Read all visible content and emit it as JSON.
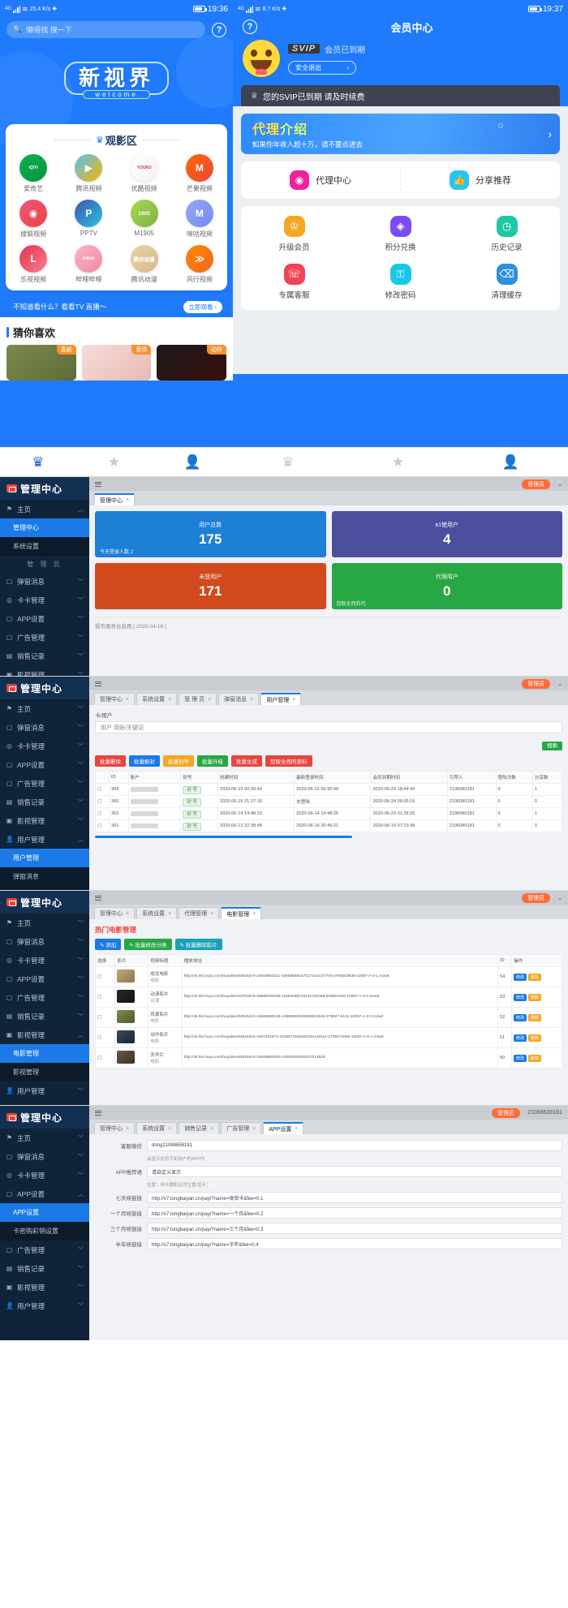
{
  "phone_home": {
    "status": {
      "network": "4G",
      "speed": "25.4 K/s",
      "time": "19:36"
    },
    "search_placeholder": "懒得找 搜一下",
    "help_icon": "question-mark-icon",
    "logo_text": "新视界",
    "logo_sub": "welcome",
    "section_title": "观影区",
    "sites": [
      {
        "name": "爱奇艺",
        "mark": "iQIYI",
        "c1": "#0cb04a",
        "c2": "#0a9440"
      },
      {
        "name": "腾讯视频",
        "mark": "▶",
        "c1": "#4fc3f7",
        "c2": "#ffb300"
      },
      {
        "name": "优酷视频",
        "mark": "YOUKU",
        "c1": "#ffffff",
        "c2": "#f2f2f2"
      },
      {
        "name": "芒果视频",
        "mark": "M",
        "c1": "#ff6a00",
        "c2": "#e8453c"
      },
      {
        "name": "搜狐视频",
        "mark": "◉",
        "c1": "#f2557f",
        "c2": "#e8453c"
      },
      {
        "name": "PPTV",
        "mark": "P",
        "c1": "#3f51b5",
        "c2": "#26c6da"
      },
      {
        "name": "M1905",
        "mark": "1905",
        "c1": "#a8d94f",
        "c2": "#7cb342"
      },
      {
        "name": "咪咕视频",
        "mark": "M",
        "c1": "#9aa7f0",
        "c2": "#6f8bf5"
      },
      {
        "name": "乐视视频",
        "mark": "L",
        "c1": "#e8304f",
        "c2": "#f2828f"
      },
      {
        "name": "哔哩哔哩",
        "mark": "bilibili",
        "c1": "#f7b3c2",
        "c2": "#f48aa4"
      },
      {
        "name": "腾讯动漫",
        "mark": "腾讯动漫",
        "c1": "#e8d3a8",
        "c2": "#d6b989"
      },
      {
        "name": "风行视频",
        "mark": "≫",
        "c1": "#ff8a00",
        "c2": "#f26522"
      }
    ],
    "ad_text": "不知道看什么？看看TV 直播～",
    "ad_button": "立即观看",
    "recommend_title": "猜你喜欢",
    "recommend": [
      {
        "tag": "喜剧",
        "c1": "#7c8a4e",
        "c2": "#5e6b3a"
      },
      {
        "tag": "爱情",
        "c1": "#f6dcd8",
        "c2": "#e8b9b4"
      },
      {
        "tag": "动作",
        "c1": "#1a1a1a",
        "c2": "#3a0d0d"
      }
    ],
    "bottom_nav": [
      {
        "icon": "crown-icon",
        "active": true
      },
      {
        "icon": "star-icon",
        "active": false
      },
      {
        "icon": "person-icon",
        "active": false
      }
    ]
  },
  "phone_member": {
    "status": {
      "network": "4G",
      "speed": "8.7 K/s",
      "time": "19:37"
    },
    "title": "会员中心",
    "help_icon": "question-mark-icon",
    "avatar": "smiley-face-avatar",
    "svip_badge": "SVIP",
    "svip_status": "会员已到期",
    "logout_label": "安全退出",
    "notice": "您的SVIP已到期 请及时续费",
    "banner": {
      "title_a": "代理",
      "title_b": "介绍",
      "subtitle": "如果你年收入超十万，请不要点进去"
    },
    "quick_rows": [
      {
        "label": "代理中心",
        "icon": "agent-icon",
        "color": "#f0229b"
      },
      {
        "label": "分享推荐",
        "icon": "thumbs-up-icon",
        "color": "#25c6f5"
      }
    ],
    "grid": [
      {
        "label": "升级会员",
        "icon": "trophy-icon",
        "color": "#f5a623"
      },
      {
        "label": "积分兑换",
        "icon": "coin-bag-icon",
        "color": "#7b4df0"
      },
      {
        "label": "历史记录",
        "icon": "clock-icon",
        "color": "#1ec8a5"
      },
      {
        "label": "专属客服",
        "icon": "headset-icon",
        "color": "#ee4455"
      },
      {
        "label": "修改密码",
        "icon": "lock-icon",
        "color": "#18c8e8"
      },
      {
        "label": "清理缓存",
        "icon": "broom-icon",
        "color": "#2d8fe0"
      }
    ],
    "bottom_nav": [
      {
        "icon": "crown-icon",
        "active": false
      },
      {
        "icon": "star-icon",
        "active": false
      },
      {
        "icon": "person-icon",
        "active": true
      }
    ]
  },
  "admin_common": {
    "brand": "管理中心",
    "badge": "管理员",
    "menu": [
      {
        "label": "主页",
        "icon": "flag-icon",
        "expandable": true
      },
      {
        "label": "管理中心",
        "icon": "home-icon",
        "sub": true
      },
      {
        "label": "系统设置",
        "icon": "gear-icon",
        "sub": true
      },
      {
        "label": "管 理 员",
        "group": true
      },
      {
        "label": "弹窗消息",
        "icon": "bell-icon",
        "expandable": true
      },
      {
        "label": "卡卡管理",
        "icon": "card-icon",
        "expandable": true
      },
      {
        "label": "APP设置",
        "icon": "app-icon",
        "expandable": true
      },
      {
        "label": "广告管理",
        "icon": "ad-icon",
        "expandable": true
      },
      {
        "label": "销售记录",
        "icon": "list-icon",
        "expandable": true
      },
      {
        "label": "影视管理",
        "icon": "film-icon",
        "expandable": true
      },
      {
        "label": "用户管理",
        "icon": "user-icon",
        "expandable": true
      }
    ]
  },
  "admin_dashboard": {
    "tabs": [
      {
        "label": "管理中心",
        "active": true
      }
    ],
    "badge": "管理员",
    "cards": [
      {
        "label": "用户总数",
        "value": "175",
        "foot": "今天登录人数 2",
        "color": "#1e7fd6"
      },
      {
        "label": "в1使用户",
        "value": "4",
        "foot": "",
        "color": "#4b4f9e"
      },
      {
        "label": "未登用户",
        "value": "171",
        "foot": "",
        "color": "#d2491b"
      },
      {
        "label": "代理用户",
        "value": "0",
        "foot": "您取全而的代",
        "color": "#27a844"
      }
    ],
    "footer": "投币服务台启用 [ 2020-04-16 ]"
  },
  "admin_users": {
    "badge": "管理员",
    "tabs": [
      {
        "label": "管理中心",
        "active": false
      },
      {
        "label": "系统设置",
        "active": false
      },
      {
        "label": "管 理 员",
        "active": false
      },
      {
        "label": "弹窗消息",
        "active": false
      },
      {
        "label": "用户管理",
        "active": true
      }
    ],
    "filter_label": "卡/用户",
    "search_placeholder": "用户 用账/关键词",
    "search_button": "搜索",
    "buttons": [
      {
        "label": "批量删除",
        "color": "#e8453c"
      },
      {
        "label": "批量解封",
        "color": "#1b7ae8"
      },
      {
        "label": "批量封号",
        "color": "#f5a623"
      },
      {
        "label": "批量升级",
        "color": "#27a844"
      },
      {
        "label": "批量生成",
        "color": "#e8453c"
      },
      {
        "label": "您取全而的资料",
        "color": "#e8453c"
      }
    ],
    "columns": [
      "",
      "ID",
      "账户",
      "封号",
      "创建时间",
      "最新登录时间",
      "会员到期时间",
      "引荐人",
      "登陆次数",
      "分享数"
    ],
    "rows": [
      {
        "id": "304",
        "acct": "",
        "ban": "封 号",
        "created": "2020-06-15 00:30:49",
        "login": "2020-06-15 00:30:49",
        "expire": "2020-06-24 18:44:49",
        "ref": "2196080181",
        "logins": "0",
        "share": "1"
      },
      {
        "id": "360",
        "acct": "",
        "ban": "封 号",
        "created": "2020-06-15 21:27:18",
        "login": "本登陆",
        "expire": "2020-06-24 06:06:16",
        "ref": "2196080181",
        "logins": "0",
        "share": "0"
      },
      {
        "id": "363",
        "acct": "",
        "ban": "封 号",
        "created": "2020-06-14 14:48:23",
        "login": "2020-06-14 14:48:25",
        "expire": "2020-06-23 01:28:25",
        "ref": "2196080181",
        "logins": "0",
        "share": "1"
      },
      {
        "id": "361",
        "acct": "",
        "ban": "封 号",
        "created": "2020-06-13 22:38:48",
        "login": "2020-06-16 20:45:21",
        "expire": "2020-06-19 07:23:48",
        "ref": "2196080181",
        "logins": "0",
        "share": "0"
      }
    ]
  },
  "admin_movies": {
    "badge": "管理员",
    "tabs": [
      {
        "label": "管理中心",
        "active": false
      },
      {
        "label": "系统设置",
        "active": false
      },
      {
        "label": "代理管理",
        "active": false
      },
      {
        "label": "电影管理",
        "active": true
      }
    ],
    "title": "热门电影管理",
    "buttons": [
      {
        "label": "添加",
        "color": "#1b7ae8"
      },
      {
        "label": "批量修改分类",
        "color": "#27a844"
      },
      {
        "label": "批量删除影片",
        "color": "#17a2b8"
      }
    ],
    "columns": [
      "选择",
      "影片",
      "视频标题",
      "播放地址",
      "ID",
      "操作"
    ],
    "rows": [
      {
        "title": "成龙电影",
        "sub": "电影",
        "url": "http://xk.hls.huya.com/huyalive/94525274-24606862211-1050885634701721414/7703-2789203838-10007-A-0-1.m3u8",
        "id": "54",
        "c1": "#c4a878",
        "c2": "#8a7450"
      },
      {
        "title": "动漫影片",
        "sub": "动漫",
        "url": "http://xk.hls.huya.com/huyalive/30763675-26896750328-11552069716101721068-049891026-10007-A-0-1.m3u8",
        "id": "53",
        "c1": "#2a2a2a",
        "c2": "#111111"
      },
      {
        "title": "风景影片",
        "sub": "电影",
        "url": "http://xk.hls.huya.com/huyalive/94525224-24606853135-10558562945082523645-278927-6124-10007-A-0-1.m3u8",
        "id": "52",
        "c1": "#7c8a4e",
        "c2": "#4e5a30"
      },
      {
        "title": "动作影片",
        "sub": "电影",
        "url": "http://xk.hls.huya.com/huyalive/94525224-2467341873-1020571525482291418112-2709274050-10007-A-0-1.m3u8",
        "id": "51",
        "c1": "#3b4a5a",
        "c2": "#1b2530"
      },
      {
        "title": "芳华片",
        "sub": "电影",
        "url": "http://xk.hls.huya.com/huyalive/94525224-24606860290-10058306250157014528",
        "id": "50",
        "c1": "#6b5a4a",
        "c2": "#3a2f24"
      }
    ],
    "op_buttons": [
      {
        "label": "修改",
        "color": "#1b7ae8"
      },
      {
        "label": "删除",
        "color": "#f5a623"
      }
    ]
  },
  "admin_app": {
    "badge": "管理员",
    "admin_code": "21068638181",
    "tabs": [
      {
        "label": "管理中心",
        "active": false
      },
      {
        "label": "系统设置",
        "active": false
      },
      {
        "label": "销售记录",
        "active": false
      },
      {
        "label": "广告管理",
        "active": false
      },
      {
        "label": "APP设置",
        "active": true
      }
    ],
    "fields": [
      {
        "label": "客服微信",
        "value": "dong21068658181",
        "hint": "会显示在您手机用户的APP内"
      },
      {
        "label": "APP推荐语",
        "value": "请自定义显示",
        "hint": "位置：用卡播影区的位置/显示；"
      },
      {
        "label": "七天续链接",
        "value": "http://v7.tongbaiyan.cn/pay/?name=体验卡&fee=0.1",
        "hint": ""
      },
      {
        "label": "一个月续链接",
        "value": "http://v7.tongbaiyan.cn/pay/?name=一个月&fee=0.2",
        "hint": ""
      },
      {
        "label": "三个月续链接",
        "value": "http://v7.tongbaiyan.cn/pay/?name=三个月&fee=0.3",
        "hint": ""
      },
      {
        "label": "半年续链接",
        "value": "http://v7.tongbaiyan.cn/pay/?name=半年&fee=0.4",
        "hint": ""
      }
    ],
    "sidebar_sub": [
      {
        "label": "APP设置",
        "active": true
      },
      {
        "label": "卡密购彩销设置",
        "active": false
      }
    ]
  }
}
